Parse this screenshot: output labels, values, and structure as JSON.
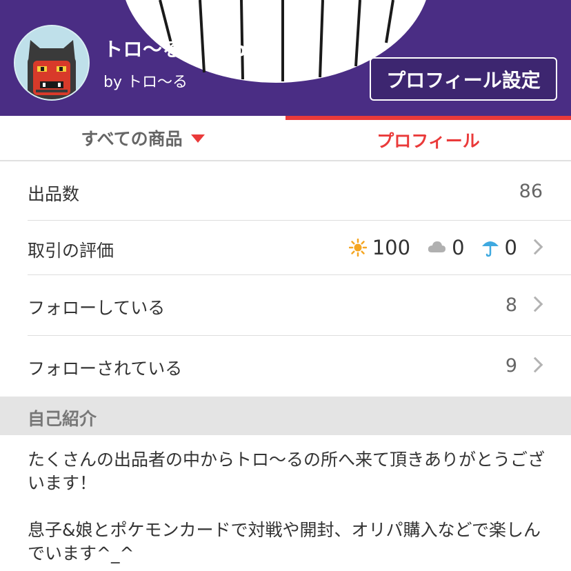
{
  "header": {
    "shop_title": "トロ〜る's shop",
    "shop_by": "by トロ〜る",
    "profile_settings_label": "プロフィール設定"
  },
  "tabs": [
    {
      "label": "すべての商品",
      "active": false
    },
    {
      "label": "プロフィール",
      "active": true
    }
  ],
  "stats": {
    "listings_label": "出品数",
    "listings_value": "86",
    "ratings_label": "取引の評価",
    "ratings": [
      {
        "icon": "sun-icon",
        "value": "100"
      },
      {
        "icon": "cloud-icon",
        "value": "0"
      },
      {
        "icon": "umbrella-icon",
        "value": "0"
      }
    ],
    "following_label": "フォローしている",
    "following_value": "8",
    "followers_label": "フォローされている",
    "followers_value": "9"
  },
  "bio": {
    "title": "自己紹介",
    "paragraphs": [
      "たくさんの出品者の中からトロ〜るの所へ来て頂きありがとうございます！",
      "息子&娘とポケモンカードで対戦や開封、オリパ購入などで楽しんでいます^_^"
    ]
  },
  "colors": {
    "header_bg": "#4a2d84",
    "accent_red": "#ea3a3a",
    "sun": "#f5a623",
    "cloud": "#b0b0b0",
    "umbrella": "#3fa9e0"
  }
}
